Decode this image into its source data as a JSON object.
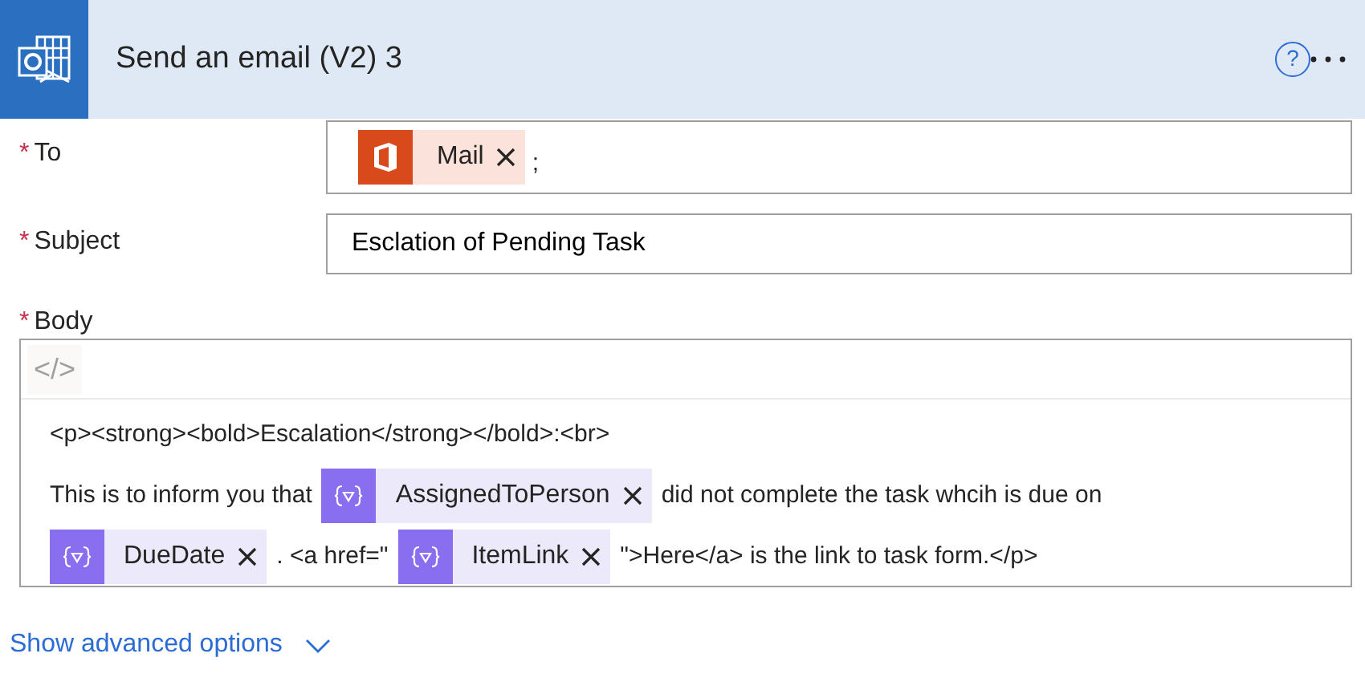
{
  "header": {
    "title": "Send an email (V2) 3",
    "help_glyph": "?"
  },
  "fields": [
    {
      "label": "To",
      "required_mark": "*",
      "kind": "recipients",
      "chips": [
        {
          "label": "Mail"
        }
      ],
      "suffix": ";"
    },
    {
      "label": "Subject",
      "required_mark": "*",
      "kind": "text",
      "value": "Esclation of Pending Task"
    }
  ],
  "body": {
    "label": "Body",
    "required_mark": "*",
    "code_toggle": "</>",
    "lines": [
      [
        {
          "kind": "text",
          "text": "<p><strong><bold>Escalation</strong></bold>:<br>"
        }
      ],
      [
        {
          "kind": "text",
          "text": "This is to inform you that"
        },
        {
          "kind": "token",
          "text": "AssignedToPerson"
        },
        {
          "kind": "text",
          "text": "did not complete the task whcih is due on"
        }
      ],
      [
        {
          "kind": "token",
          "text": "DueDate"
        },
        {
          "kind": "text",
          "text": ". <a href=\""
        },
        {
          "kind": "token",
          "text": "ItemLink"
        },
        {
          "kind": "text",
          "text": "\">Here</a> is the link to task form.</p>"
        }
      ]
    ]
  },
  "advanced_link": "Show advanced options"
}
